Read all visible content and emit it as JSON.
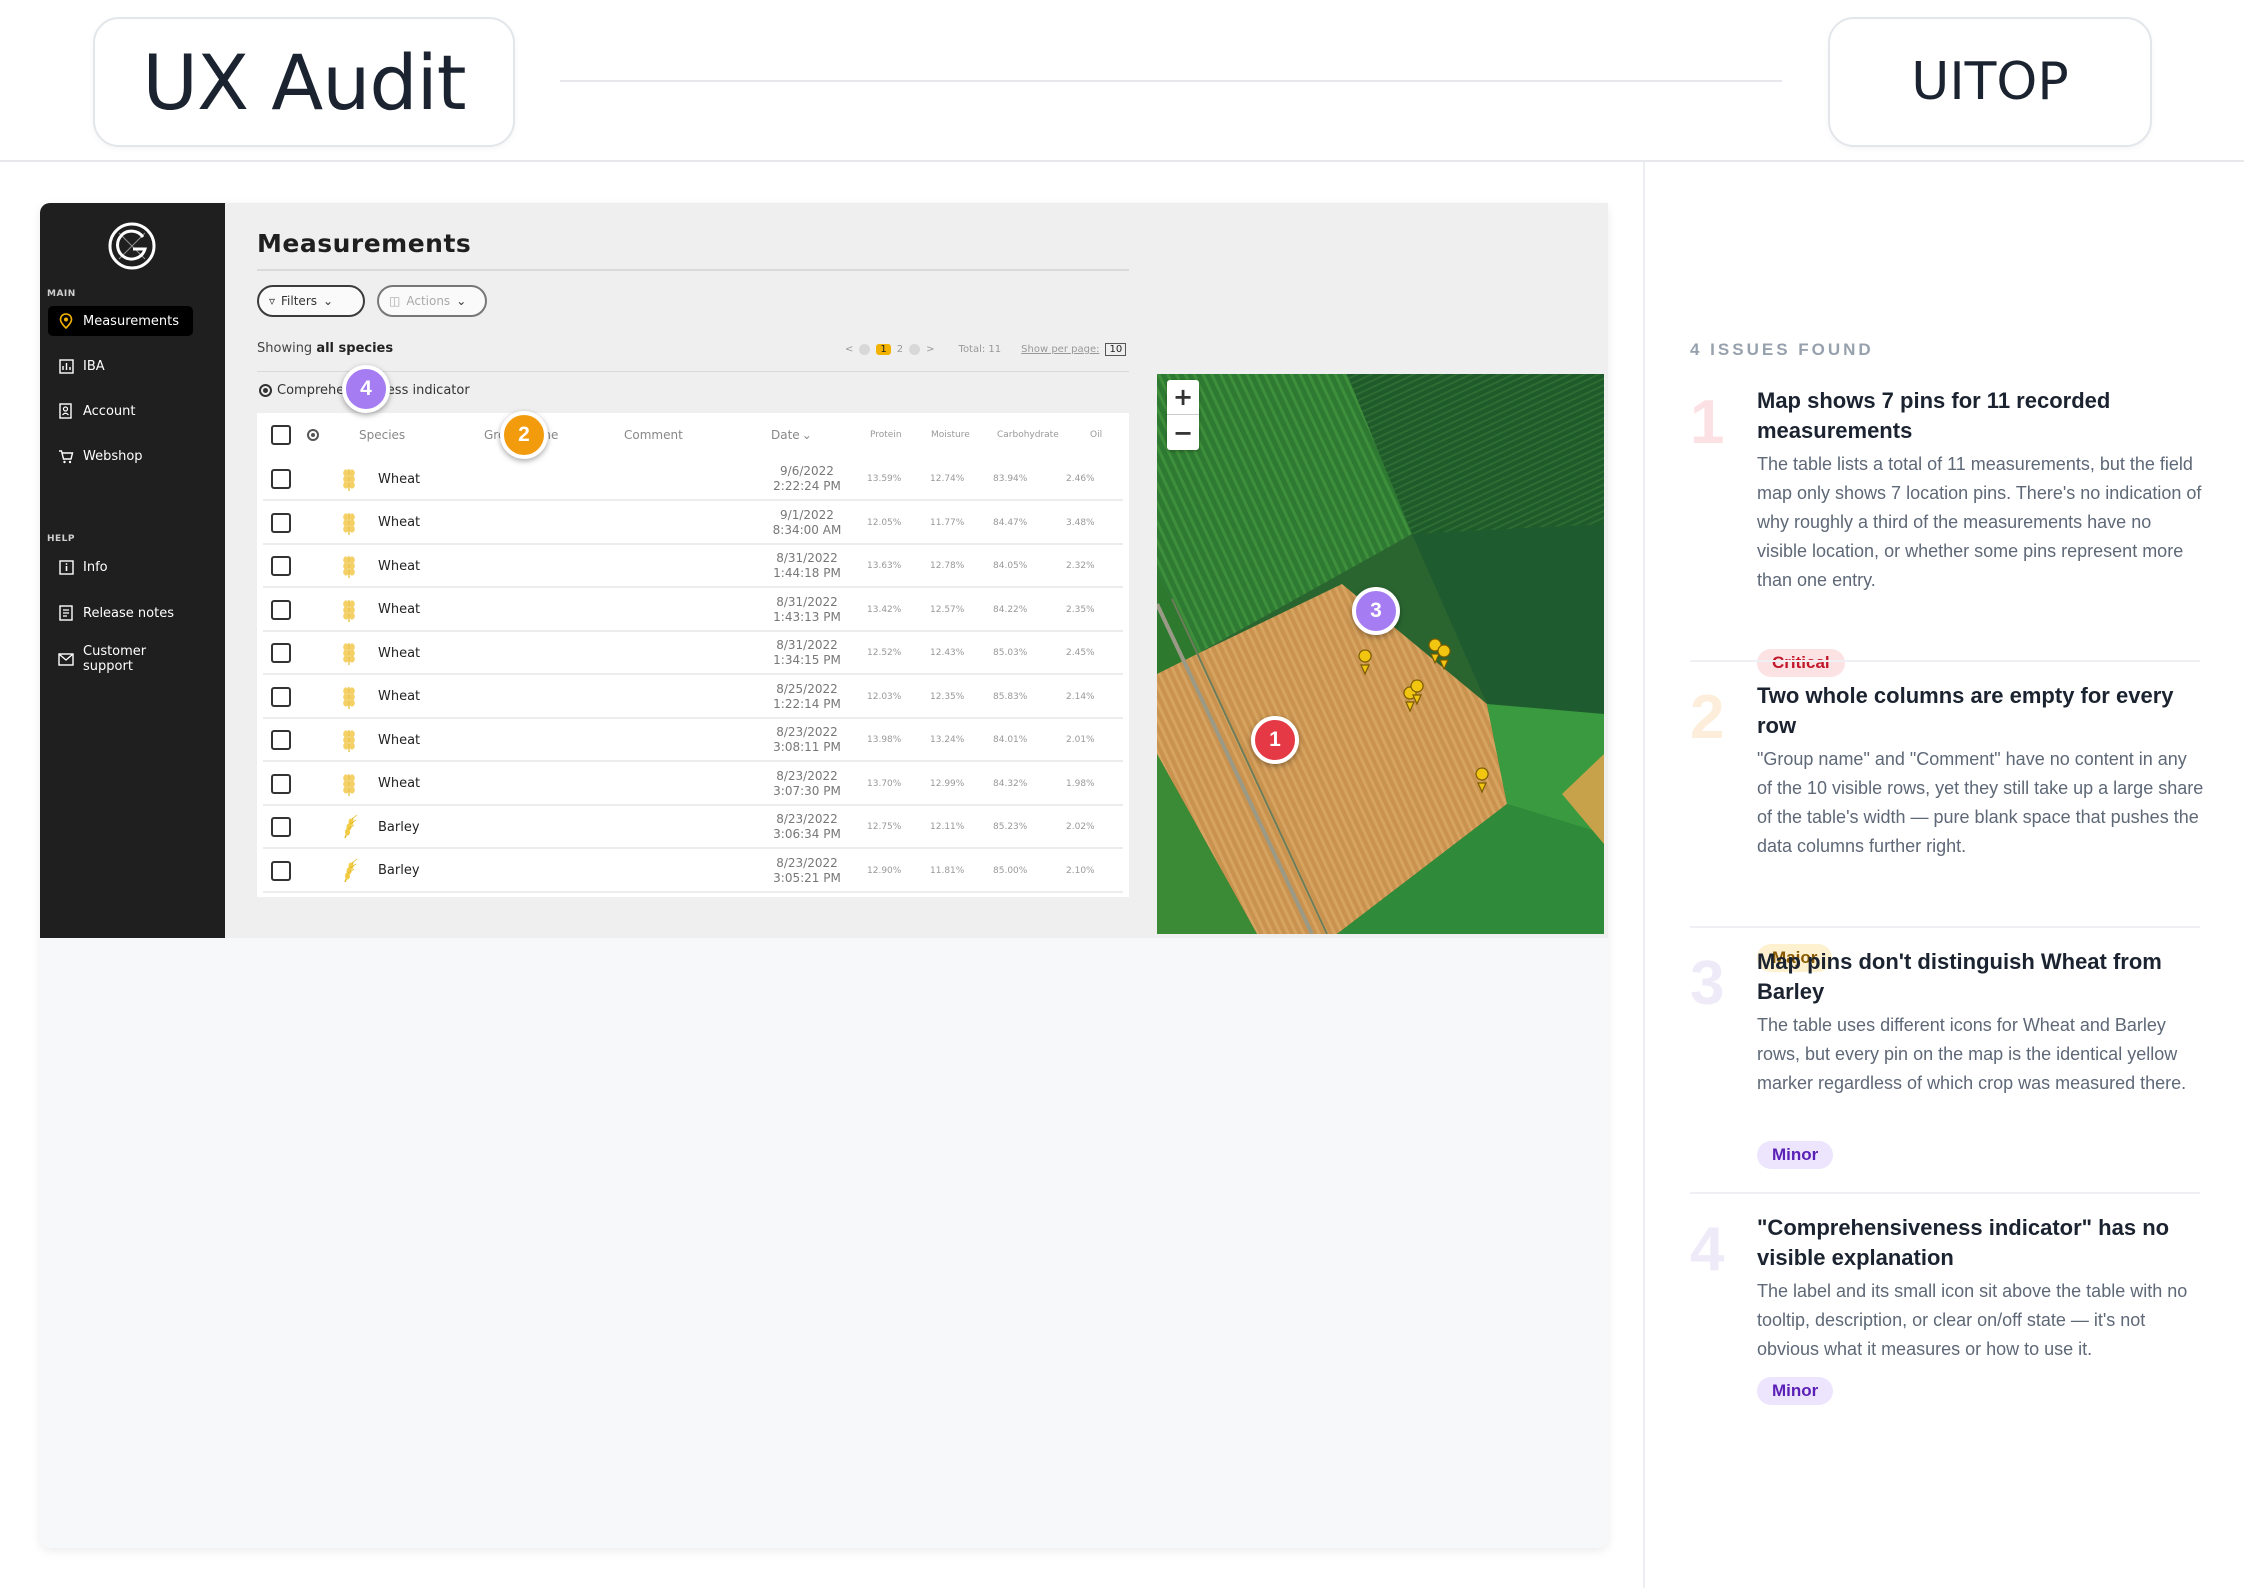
{
  "header": {
    "title": "UX Audit",
    "brand": "UITOP"
  },
  "app": {
    "sidebar": {
      "section_main": "MAIN",
      "section_help": "HELP",
      "items": [
        {
          "label": "Measurements",
          "icon": "location-pin-icon",
          "active": true
        },
        {
          "label": "IBA",
          "icon": "chart-icon"
        },
        {
          "label": "Account",
          "icon": "account-icon"
        },
        {
          "label": "Webshop",
          "icon": "cart-icon"
        },
        {
          "label": "Info",
          "icon": "info-icon"
        },
        {
          "label": "Release notes",
          "icon": "notes-icon"
        },
        {
          "label": "Customer support",
          "icon": "mail-icon"
        }
      ]
    },
    "page_title": "Measurements",
    "filters_label": "Filters",
    "actions_label": "Actions",
    "showing_prefix": "Showing",
    "showing_value": "all species",
    "pagination": {
      "prev": "<",
      "current": "1",
      "next_page": "2",
      "next": ">",
      "total": "Total: 11",
      "per_page_label": "Show per page:",
      "per_page_value": "10"
    },
    "comprehensiveness_label": "Comprehensiveness indicator",
    "table": {
      "columns": [
        "Species",
        "Group name",
        "Comment",
        "Date",
        "Protein",
        "Moisture",
        "Carbohydrate",
        "Oil"
      ],
      "rows": [
        {
          "species": "Wheat",
          "date": "9/6/2022",
          "time": "2:22:24 PM",
          "protein": "13.59%",
          "moisture": "12.74%",
          "carb": "83.94%",
          "oil": "2.46%"
        },
        {
          "species": "Wheat",
          "date": "9/1/2022",
          "time": "8:34:00 AM",
          "protein": "12.05%",
          "moisture": "11.77%",
          "carb": "84.47%",
          "oil": "3.48%"
        },
        {
          "species": "Wheat",
          "date": "8/31/2022",
          "time": "1:44:18 PM",
          "protein": "13.63%",
          "moisture": "12.78%",
          "carb": "84.05%",
          "oil": "2.32%"
        },
        {
          "species": "Wheat",
          "date": "8/31/2022",
          "time": "1:43:13 PM",
          "protein": "13.42%",
          "moisture": "12.57%",
          "carb": "84.22%",
          "oil": "2.35%"
        },
        {
          "species": "Wheat",
          "date": "8/31/2022",
          "time": "1:34:15 PM",
          "protein": "12.52%",
          "moisture": "12.43%",
          "carb": "85.03%",
          "oil": "2.45%"
        },
        {
          "species": "Wheat",
          "date": "8/25/2022",
          "time": "1:22:14 PM",
          "protein": "12.03%",
          "moisture": "12.35%",
          "carb": "85.83%",
          "oil": "2.14%"
        },
        {
          "species": "Wheat",
          "date": "8/23/2022",
          "time": "3:08:11 PM",
          "protein": "13.98%",
          "moisture": "13.24%",
          "carb": "84.01%",
          "oil": "2.01%"
        },
        {
          "species": "Wheat",
          "date": "8/23/2022",
          "time": "3:07:30 PM",
          "protein": "13.70%",
          "moisture": "12.99%",
          "carb": "84.32%",
          "oil": "1.98%"
        },
        {
          "species": "Barley",
          "date": "8/23/2022",
          "time": "3:06:34 PM",
          "protein": "12.75%",
          "moisture": "12.11%",
          "carb": "85.23%",
          "oil": "2.02%"
        },
        {
          "species": "Barley",
          "date": "8/23/2022",
          "time": "3:05:21 PM",
          "protein": "12.90%",
          "moisture": "11.81%",
          "carb": "85.00%",
          "oil": "2.10%"
        }
      ]
    },
    "map": {
      "zoom_in": "+",
      "zoom_out": "−"
    }
  },
  "markers": [
    "1",
    "2",
    "3",
    "4"
  ],
  "panel": {
    "heading": "4 ISSUES FOUND",
    "issues": [
      {
        "number": "1",
        "title": "Map shows 7 pins for 11 recorded measurements",
        "body": "The table lists a total of 11 measurements, but the field map only shows 7 location pins. There's no indication of why roughly a third of the measurements have no visible location, or whether some pins represent more than one entry.",
        "severity": "Critical",
        "color": "#e53945"
      },
      {
        "number": "2",
        "title": "Two whole columns are empty for every row",
        "body": "\"Group name\" and \"Comment\" have no content in any of the 10 visible rows, yet they still take up a large share of the table's width — pure blank space that pushes the data columns further right.",
        "severity": "Major",
        "color": "#f29c0d"
      },
      {
        "number": "3",
        "title": "Map pins don't distinguish Wheat from Barley",
        "body": "The table uses different icons for Wheat and Barley rows, but every pin on the map is the identical yellow marker regardless of which crop was measured there.",
        "severity": "Minor",
        "color": "#a57cf2"
      },
      {
        "number": "4",
        "title": "\"Comprehensiveness indicator\" has no visible explanation",
        "body": "The label and its small icon sit above the table with no tooltip, description, or clear on/off state — it's not obvious what it measures or how to use it.",
        "severity": "Minor",
        "color": "#a57cf2"
      }
    ]
  }
}
